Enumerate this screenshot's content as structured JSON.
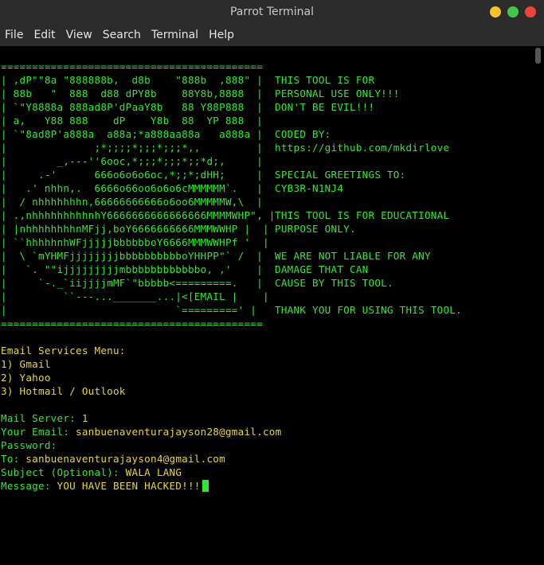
{
  "window": {
    "title": "Parrot Terminal",
    "buttons": [
      {
        "name": "minimize",
        "color": "#f5c12e"
      },
      {
        "name": "maximize",
        "color": "#43c64b"
      },
      {
        "name": "close",
        "color": "#e9463c"
      }
    ]
  },
  "menu": [
    "File",
    "Edit",
    "View",
    "Search",
    "Terminal",
    "Help"
  ],
  "banner": {
    "border": "==========================================",
    "art": [
      "| ,dP\"\"8a \"888888b,  d8b    \"888b  ,888\" |",
      "| 88b   \"  888  d88 dPY8b    88Y8b,8888  |",
      "| `\"Y8888a 888ad8P'dPaaY8b   88 Y88P888  |",
      "| a,   Y88 888    dP    Y8b  88  YP 888  |",
      "| `\"8ad8P'a888a  a88a;*a888aa88a   a888a |",
      "|              ;*;;;;*;;;*;;;*,,         |",
      "|        _,---''6ooc,*;;;*;;;*;;*d;,     |",
      "|     .-'      666o6o6o6oc,*;;*;dHH;     |",
      "|   .' nhhn,.  6666o66oo6o6o6cMMMMMM`.   |",
      "|  / nhhhhhhhn,66666666666o6oo6MMMMMW,\\  |",
      "| .,nhhhhhhhhhnhY6666666666666666MMMMWHP\", |",
      "| |nhhhhhhhhnMFjj,boY6666666666MMMWWHP |  |",
      "| ``hhhhhnhWFjjjjjbbbbbboY6666MMMWWHPf '  |",
      "|  \\ `mYHMFjjjjjjjjbbbbbbbbbboYHHPP\"` /  |",
      "|   `. \"\"ijjjjjjjjjmbbbbbbbbbbbbo, ,'    |",
      "|     `-._`iijjjjmMF`\"bbbbb<=========.   |",
      "|         ``---..._______...|<[EMAIL |    |",
      "|                           `=========' |"
    ],
    "notes": [
      "THIS TOOL IS FOR",
      "PERSONAL USE ONLY!!!",
      "DON'T BE EVIL!!!",
      "",
      "CODED BY:",
      "https://github.com/mkdirlove",
      "",
      "SPECIAL GREETINGS TO:",
      "CYB3R-N1NJ4",
      "",
      "THIS TOOL IS FOR EDUCATIONAL",
      "PURPOSE ONLY.",
      "",
      "WE ARE NOT LIABLE FOR ANY",
      "DAMAGE THAT CAN",
      "CAUSE BY THIS TOOL.",
      "",
      "THANK YOU FOR USING THIS TOOL."
    ]
  },
  "session": {
    "menu_title": "Email Services Menu:",
    "options": [
      "1) Gmail",
      "2) Yahoo",
      "3) Hotmail / Outlook"
    ],
    "mail_server": {
      "label": "Mail Server: ",
      "value": "1"
    },
    "your_email": {
      "label": "Your Email: ",
      "value": "sanbuenaventurajayson28@gmail.com"
    },
    "password": {
      "label": "Password:",
      "value": ""
    },
    "to": {
      "label": "To: ",
      "value": "sanbuenaventurajayson4@gmail.com"
    },
    "subject": {
      "label": "Subject (Optional): ",
      "value": "WALA LANG"
    },
    "message": {
      "label": "Message: ",
      "value": "YOU HAVE BEEN HACKED!!!"
    }
  },
  "colors": {
    "prompt_green": "#33e833",
    "input_yellow": "#e8d43c",
    "titlebar": "#2b2b2b"
  }
}
